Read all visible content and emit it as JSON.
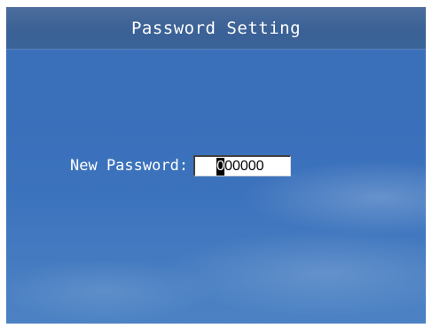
{
  "window": {
    "title": "Password Setting"
  },
  "form": {
    "new_password_label": "New Password:",
    "password_first_char": "0",
    "password_rest": "00000"
  },
  "colors": {
    "title_bar": "#3b6196",
    "background": "#3b70b9",
    "text": "#ffffff"
  }
}
